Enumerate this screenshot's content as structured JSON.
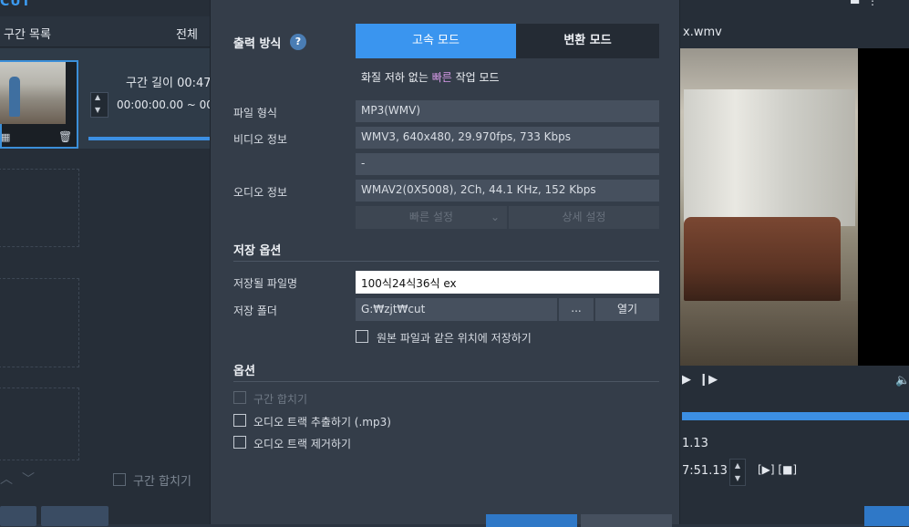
{
  "left": {
    "logo": "CUT",
    "list_title": "구간 목록",
    "list_all": "전체 ",
    "segment_length": "구간 길이 00:47",
    "segment_time": "00:00:00.00 ~ 00:",
    "merge_label": "구간 합치기"
  },
  "right": {
    "filename": "x.wmv",
    "time_1": "1.13",
    "time_2": "7:51.13",
    "play_controls": "[▶] [■]"
  },
  "dialog": {
    "output_mode_label": "출력 방식",
    "help": "?",
    "mode_fast": "고속 모드",
    "mode_convert": "변환 모드",
    "mode_desc_a": "화질 저하 없는 ",
    "mode_desc_hl": "빠른",
    "mode_desc_b": " 작업 모드",
    "file_format_label": "파일 형식",
    "file_format_value": "MP3(WMV)",
    "video_info_label": "비디오 정보",
    "video_info_value": "WMV3, 640x480, 29.970fps, 733 Kbps",
    "video_info_value2": "-",
    "audio_info_label": "오디오 정보",
    "audio_info_value": "WMAV2(0X5008), 2Ch, 44.1 KHz, 152 Kbps",
    "quick_settings": "빠른 설정",
    "detail_settings": "상세 설정",
    "save_options_title": "저장 옵션",
    "save_filename_label": "저장될 파일명",
    "save_filename_value": "100식24식36식 ex",
    "save_folder_label": "저장 폴더",
    "save_folder_value": "G:₩zjt₩cut",
    "browse": "...",
    "open": "열기",
    "same_location": "원본 파일과 같은 위치에 저장하기",
    "options_title": "옵션",
    "opt_merge": "구간 합치기",
    "opt_extract_audio": "오디오 트랙 추출하기 (.mp3)",
    "opt_remove_audio": "오디오 트랙 제거하기"
  }
}
